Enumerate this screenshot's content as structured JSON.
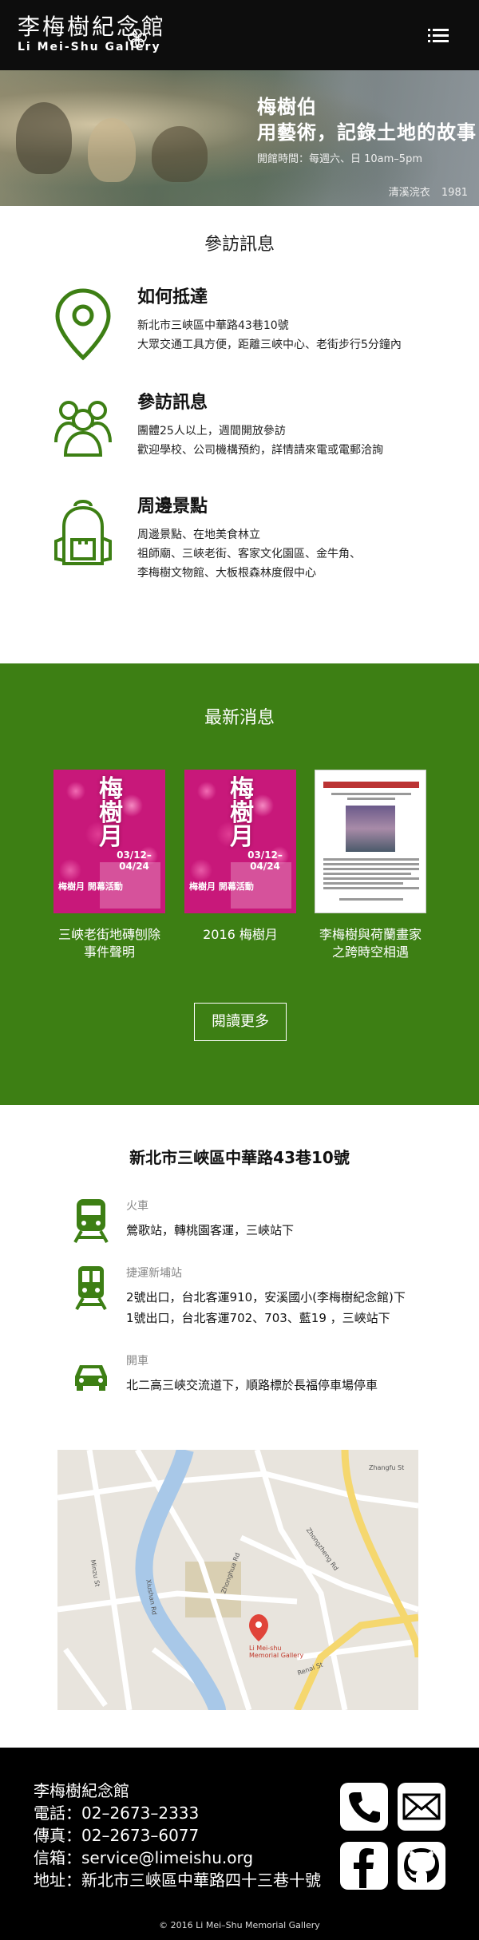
{
  "header": {
    "logo_cn": "李梅樹紀念館",
    "logo_en": "Li Mei-Shu Gallery"
  },
  "hero": {
    "title_line1": "梅樹伯",
    "title_line2": "用藝術，記錄土地的故事",
    "hours": "開館時間：每週六、日 10am–5pm",
    "caption_title": "清溪浣衣",
    "caption_year": "1981"
  },
  "visit": {
    "title": "參訪訊息",
    "items": [
      {
        "icon": "map-pin-icon",
        "heading": "如何抵達",
        "lines": [
          "新北市三峽區中華路43巷10號",
          "大眾交通工具方便，距離三峽中心、老街步行5分鐘內"
        ]
      },
      {
        "icon": "group-icon",
        "heading": "參訪訊息",
        "lines": [
          "團體25人以上，週間開放參訪",
          "歡迎學校、公司機構預約，詳情請來電或電郵洽詢"
        ]
      },
      {
        "icon": "backpack-icon",
        "heading": "周邊景點",
        "lines": [
          "周邊景點、在地美食林立",
          "祖師廟、三峽老街、客家文化園區、金牛角、",
          "李梅樹文物館、大板根森林度假中心"
        ]
      }
    ]
  },
  "news": {
    "title": "最新消息",
    "items": [
      {
        "caption_line1": "三峽老街地磚刨除",
        "caption_line2": "事件聲明",
        "poster_title": "梅樹月",
        "poster_date": "03/12–04/24",
        "poster_foot": "梅樹月 開幕活動"
      },
      {
        "caption_line1": "2016 梅樹月",
        "caption_line2": "",
        "poster_title": "梅樹月",
        "poster_date": "03/12–04/24",
        "poster_foot": "梅樹月 開幕活動"
      },
      {
        "caption_line1": "李梅樹與荷蘭畫家",
        "caption_line2": "之跨時空相遇",
        "poster_title": "",
        "poster_date": "",
        "poster_foot": ""
      }
    ],
    "more_label": "閱讀更多"
  },
  "transport": {
    "address": "新北市三峽區中華路43巷10號",
    "items": [
      {
        "icon": "train-icon",
        "label": "火車",
        "lines": [
          "鶯歌站，轉桃園客運，三峽站下"
        ]
      },
      {
        "icon": "metro-icon",
        "label": "捷運新埔站",
        "lines": [
          "2號出口，台北客運910，安溪國小(李梅樹紀念館)下",
          "1號出口，台北客運702、703、藍19 ，三峽站下"
        ]
      },
      {
        "icon": "car-icon",
        "label": "開車",
        "lines": [
          "北二高三峽交流道下，順路標於長福停車場停車"
        ]
      }
    ],
    "map": {
      "marker_label_line1": "Li Mei-shu",
      "marker_label_line2": "Memorial Gallery",
      "streets": [
        "Zhonghua Rd",
        "Xiushan Rd",
        "Zhongzheng Rd",
        "Zhangfu St",
        "Minzu St",
        "Renai St"
      ]
    }
  },
  "footer": {
    "name": "李梅樹紀念館",
    "phone": "電話：02–2673–2333",
    "fax": "傳真：02–2673–6077",
    "email": "信箱：service@limeishu.org",
    "address": "地址：新北市三峽區中華路四十三巷十號",
    "copyright": "© 2016 Li Mei–Shu Memorial Gallery"
  },
  "colors": {
    "accent_green": "#3d7f14",
    "header_bg": "#0d0d0d",
    "footer_bg": "#000000",
    "poster_pink": "#c8187a"
  }
}
